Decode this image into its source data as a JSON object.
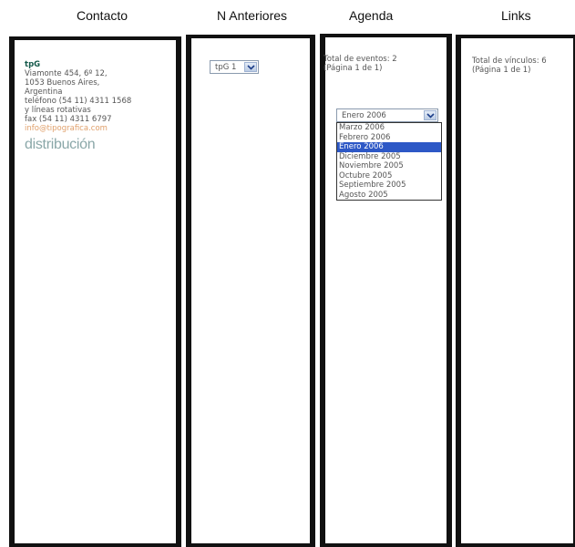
{
  "headers": {
    "contacto": "Contacto",
    "anteriores": "N Anteriores",
    "agenda": "Agenda",
    "links": "Links"
  },
  "contact": {
    "brand": "tpG",
    "address1": "Viamonte 454, 6º 12,",
    "address2": "1053 Buenos Aires,",
    "country": "Argentina",
    "phone": "teléfono (54 11) 4311 1568",
    "lines": "y líneas rotativas",
    "fax": "fax (54 11) 4311 6797",
    "email": "info@tipografica.com",
    "distribution": "distribución"
  },
  "anteriores": {
    "selected": "tpG 1"
  },
  "agenda": {
    "total": "Total de eventos: 2",
    "page": "(Página 1 de 1)",
    "selected": "Enero 2006",
    "options": [
      "Marzo 2006",
      "Febrero 2006",
      "Enero 2006",
      "Diciembre 2005",
      "Noviembre 2005",
      "Octubre 2005",
      "Septiembre 2005",
      "Agosto 2005"
    ],
    "highlighted_index": 2
  },
  "links": {
    "total": "Total de vínculos: 6",
    "page": "(Página 1 de 1)"
  },
  "colors": {
    "border": "#111111",
    "brand": "#14594a",
    "email": "#e0a06b",
    "highlight": "#2d58c6"
  }
}
